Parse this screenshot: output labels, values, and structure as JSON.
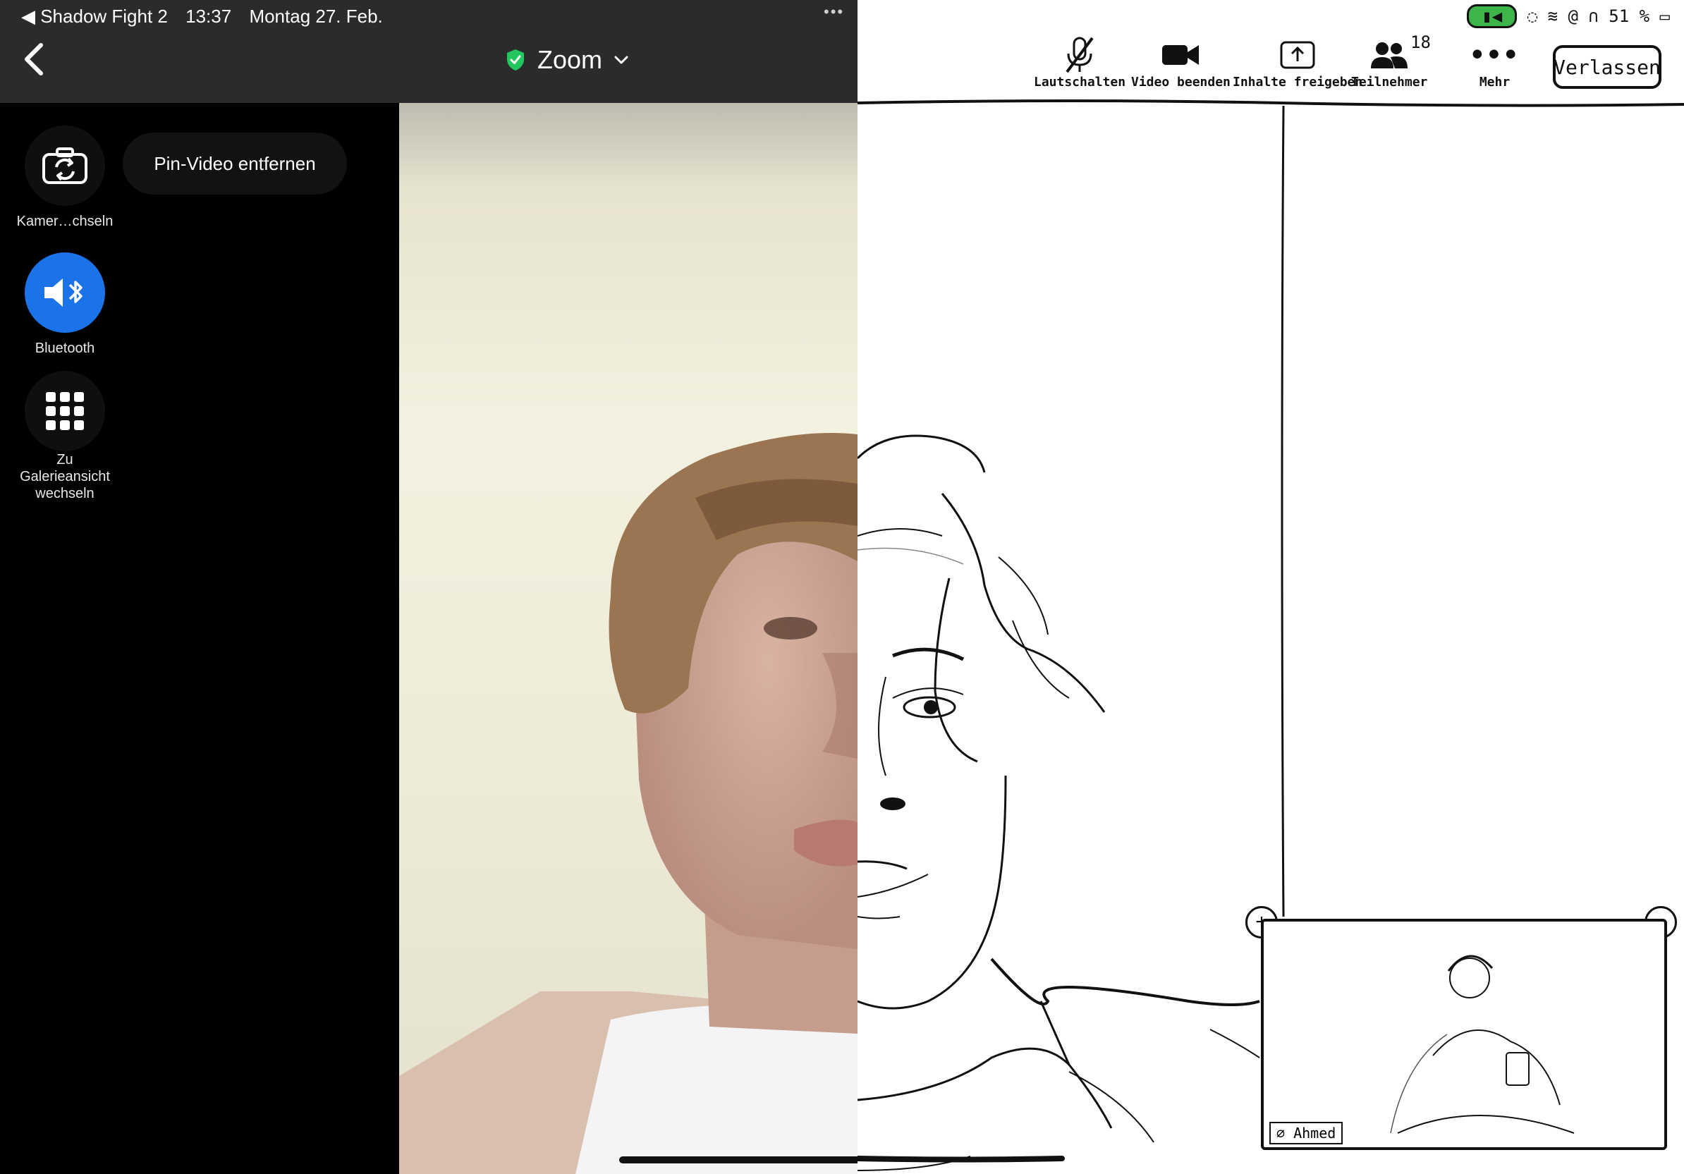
{
  "status_bar": {
    "back_app": "◀ Shadow Fight 2",
    "time": "13:37",
    "date": "Montag 27. Feb.",
    "battery": "51 %"
  },
  "header": {
    "title": "Zoom"
  },
  "side_controls": {
    "switch_camera_label": "Kamer…chseln",
    "pin_video_label": "Pin-Video entfernen",
    "bluetooth_label": "Bluetooth",
    "gallery_label_1": "Zu",
    "gallery_label_2": "Galerieansicht",
    "gallery_label_3": "wechseln"
  },
  "toolbar": {
    "mute_label": "Lautschalten",
    "video_label": "Video beenden",
    "share_label": "Inhalte freigeben",
    "participants_label": "Teilnehmer",
    "participants_count": "18",
    "more_label": "Mehr",
    "leave_label": "Verlassen"
  },
  "pip": {
    "name": "Ahmed"
  },
  "colors": {
    "accent_blue": "#1a73e8",
    "shield_green": "#22c55e"
  }
}
